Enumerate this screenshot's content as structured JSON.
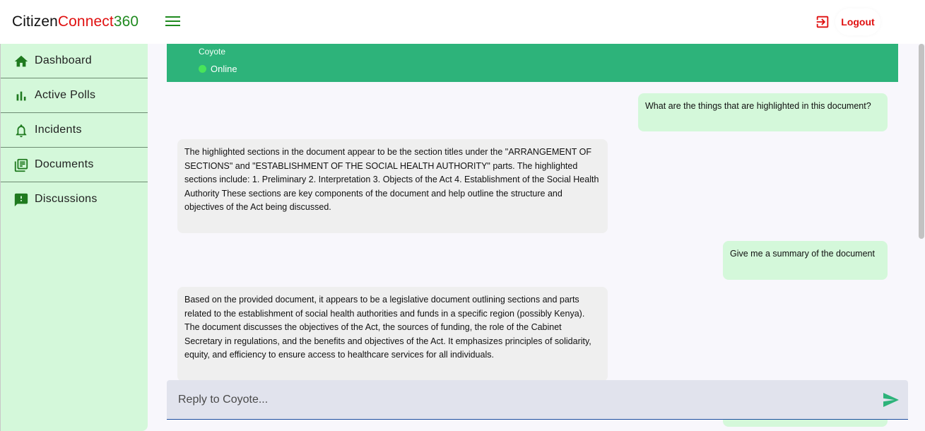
{
  "app": {
    "logo": {
      "part1": "Citizen",
      "part2": "Connect",
      "part3": "360"
    },
    "logout_label": "Logout"
  },
  "sidebar": {
    "items": [
      {
        "label": "Dashboard",
        "icon": "home-icon"
      },
      {
        "label": "Active Polls",
        "icon": "bar-chart-icon"
      },
      {
        "label": "Incidents",
        "icon": "bell-icon"
      },
      {
        "label": "Documents",
        "icon": "library-books-icon"
      },
      {
        "label": "Discussions",
        "icon": "feedback-icon"
      }
    ]
  },
  "chat": {
    "contact_name": "Coyote",
    "status": "Online",
    "messages": [
      {
        "role": "user",
        "text": "What are the things that are highlighted in this document?"
      },
      {
        "role": "bot",
        "text": "The highlighted sections in the document appear to be the section titles under the \"ARRANGEMENT OF SECTIONS\" and \"ESTABLISHMENT OF THE SOCIAL HEALTH AUTHORITY\" parts. The highlighted sections include: 1. Preliminary 2. Interpretation 3. Objects of the Act 4. Establishment of the Social Health Authority These sections are key components of the document and help outline the structure and objectives of the Act being discussed."
      },
      {
        "role": "user",
        "text": "Give me a summary of the document"
      },
      {
        "role": "bot",
        "text": "Based on the provided document, it appears to be a legislative document outlining sections and parts related to the establishment of social health authorities and funds in a specific region (possibly Kenya). The document discusses the objectives of the Act, the sources of funding, the role of the Cabinet Secretary in regulations, and the benefits and objectives of the Act. It emphasizes principles of solidarity, equity, and efficiency to ensure access to healthcare services for all individuals."
      }
    ],
    "reply_placeholder": "Reply to Coyote..."
  },
  "colors": {
    "brand_green": "#2db37a",
    "sidebar_bg": "#d4f8da",
    "logout_red": "#e01010",
    "online_dot": "#48e45a"
  }
}
